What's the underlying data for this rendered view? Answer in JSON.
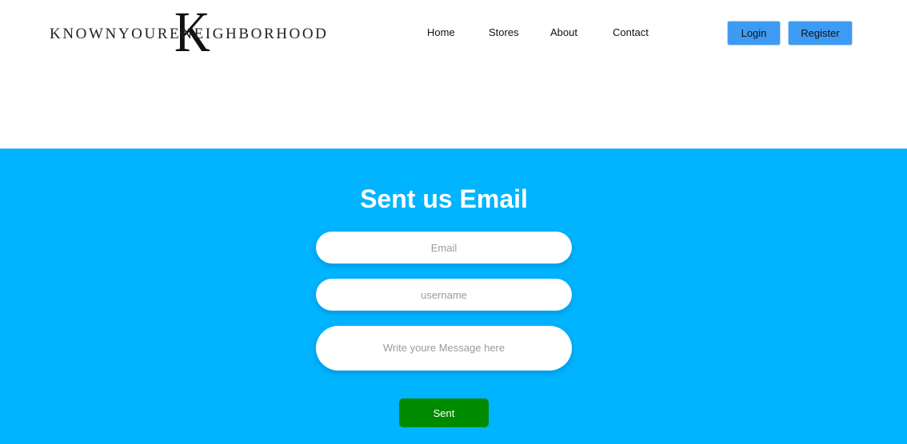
{
  "brand": {
    "logo_letter": "K",
    "logo_text": "KnownYoureNeighborhood"
  },
  "nav": {
    "home": "Home",
    "stores": "Stores",
    "about": "About",
    "contact": "Contact"
  },
  "auth": {
    "login": "Login",
    "register": "Register"
  },
  "contact_form": {
    "title": "Sent us Email",
    "email_placeholder": "Email",
    "username_placeholder": "username",
    "message_placeholder": "Write youre Message here",
    "submit_label": "Sent"
  },
  "colors": {
    "section_background": "#00b4ff",
    "auth_button": "#3d9bf3",
    "submit_button": "#008a00"
  }
}
